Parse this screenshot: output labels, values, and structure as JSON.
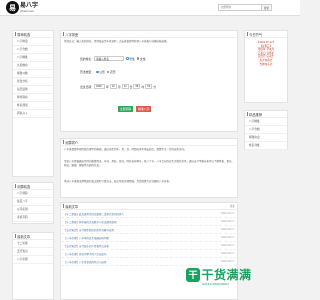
{
  "header": {
    "logo_char": "易",
    "logo_title": "易八字",
    "logo_sub": "yibazi.com",
    "search_placeholder": "立即查询",
    "search_button": "搜索"
  },
  "sidebar": {
    "title1": "算命精选",
    "items1": [
      "八字排盘",
      "八字合婚",
      "八字精批",
      "九星推命",
      "紫微斗数",
      "星盘分析",
      "每日运势",
      "称骨算命",
      "姓名测试",
      "周易占卜"
    ],
    "title2": "测算精选",
    "items2": [
      "八字测算",
      "生辰八字",
      "公司名测",
      "手机号码"
    ],
    "title3": "最新文章",
    "items3": [
      "十二星座",
      "五行知识",
      "八字命理"
    ]
  },
  "tool": {
    "title": "八字排盘",
    "desc": "测试方法：输入您的姓名、性别及出生年月日时，点击排盘即可获得八字排盘与详细分析结果。",
    "name_label": "您的姓名：",
    "name_placeholder": "请输入姓名",
    "gender_male": "男性",
    "gender_female": "女性",
    "cal_label": "历法类型：",
    "cal_solar": "公历",
    "cal_lunar": "农历",
    "birth_label": "出生日期：",
    "year": "2000",
    "year_unit": "年",
    "month": "10",
    "month_unit": "月",
    "day": "12",
    "day_unit": "日",
    "hour": "08",
    "hour_unit": "时",
    "minute": "00",
    "minute_unit": "分",
    "btn_submit": "立即测算",
    "btn_fine": "精准八字"
  },
  "intro": {
    "title": "测算简介",
    "p1": "八字排盘是中国传统命理学的基础，通过出生的年、月、日、时四柱天干地支组合，推算命主一生的运势走向。",
    "p2": "生辰八字是根据出生时间推算而来，年柱、月柱、日柱、时柱各有两字，共八个字。八字之间存在生克制化关系，通过五行平衡分析可以了解性格、事业、财运、婚姻、健康等方面的信息。",
    "p3": "本站八字排盘采用精准的真太阳时计算方法，结合传统命理经典，为您提供专业详细的八字分析。"
  },
  "recent": {
    "title": "最新文章",
    "more": "更多",
    "items": [
      {
        "title": "【十二星座】处女座男生的恋爱观：追求完美的好男人",
        "date": "2024-10-17"
      },
      {
        "title": "【十二星座】射手座的幸运数字与幸运颜色指南",
        "date": "2024-10-17"
      },
      {
        "title": "【五行知识】五行相生相克的关系详解与应用",
        "date": "2024-10-17"
      },
      {
        "title": "【八字命理】八字中的日主强弱如何判断",
        "date": "2024-10-17"
      },
      {
        "title": "【五行知识】五行缺水的人性格特点分析",
        "date": "2024-10-17"
      },
      {
        "title": "【八字命理】日柱为甲子的人命运如何",
        "date": "2024-10-17"
      },
      {
        "title": "【八字命理】八字正官格的特点与运势",
        "date": "2024-10-17"
      }
    ]
  },
  "today": {
    "title": "今日节气",
    "lines": [
      "【2024-07-17】",
      "【星期三】",
      "甲辰年 辛未月",
      "乙亥日 宜祭祀",
      "宜出行 忌动土",
      "太岁在南方",
      "吉神在东北"
    ]
  },
  "hot": {
    "title": "精品推荐",
    "items": [
      "八字精批",
      "八字合婚",
      "紫微命盘",
      "姓名详批"
    ]
  },
  "watermark": {
    "icon": "干",
    "text": "干货满满",
    "sub": "GANHUOMANMAN"
  },
  "colors": {
    "accent": "#3a8ee6",
    "btn_green": "#2eaa5c",
    "btn_red": "#e05a4a",
    "brand_green": "#1aa260"
  }
}
